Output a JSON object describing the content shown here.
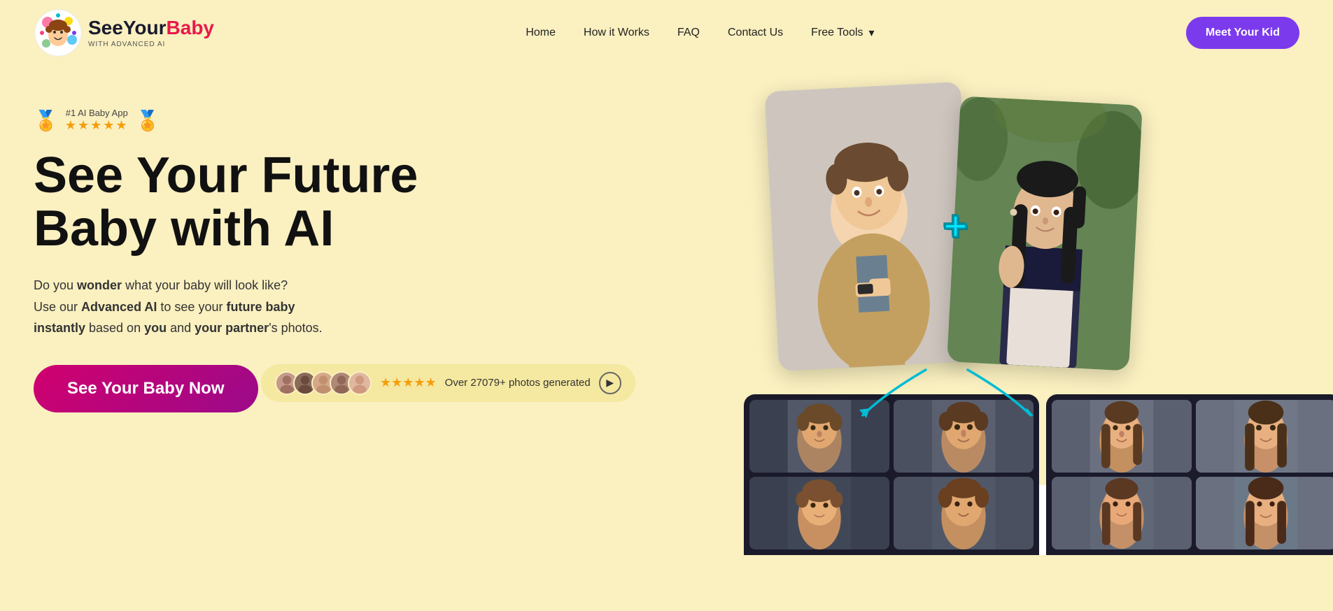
{
  "nav": {
    "logo_see": "See",
    "logo_your": "Your",
    "logo_baby": "Baby",
    "logo_sub": "WITH ADVANCED AI",
    "links": [
      {
        "label": "Home",
        "id": "home"
      },
      {
        "label": "How it Works",
        "id": "how-it-works"
      },
      {
        "label": "FAQ",
        "id": "faq"
      },
      {
        "label": "Contact Us",
        "id": "contact"
      },
      {
        "label": "Free Tools",
        "id": "free-tools"
      }
    ],
    "cta_label": "Meet Your Kid"
  },
  "hero": {
    "badge_label": "#1 AI Baby App",
    "stars": "★★★★★",
    "heading_line1": "See Your Future",
    "heading_line2": "Baby with AI",
    "desc_part1": "Do you ",
    "desc_bold1": "wonder",
    "desc_part2": " what your baby will look like?",
    "desc_part3": "Use our ",
    "desc_bold2": "Advanced AI",
    "desc_part4": " to see your ",
    "desc_bold3": "future baby",
    "desc_bold4": " instantly",
    "desc_part5": " based on ",
    "desc_bold5": "you",
    "desc_part6": " and ",
    "desc_bold6": "your partner",
    "desc_part7": "'s photos.",
    "cta_label": "See Your Baby Now",
    "proof_text": "Over 27079+ photos generated",
    "proof_stars": "★★★★★",
    "plus_symbol": "+"
  },
  "colors": {
    "background": "#faf0c0",
    "cta_gradient_start": "#d1006e",
    "cta_gradient_end": "#9b0a8a",
    "meet_btn": "#7c3aed",
    "plus_color": "#00bcd4",
    "star_color": "#f59e0b"
  }
}
